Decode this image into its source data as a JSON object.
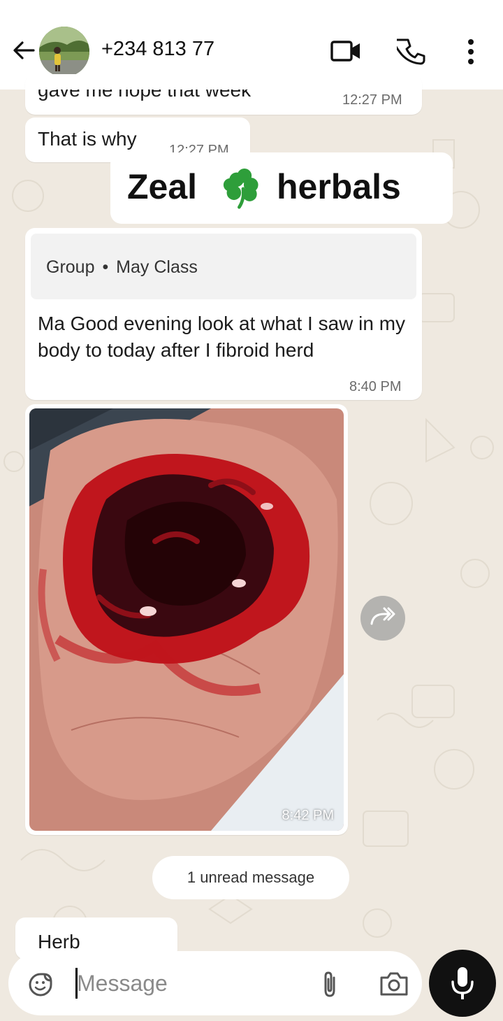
{
  "header": {
    "contact": "+234 813 77       "
  },
  "messages": {
    "m1": {
      "text": "gave me hope that week",
      "time": "12:27 PM"
    },
    "m2": {
      "text": "That is why",
      "time": "12:27 PM"
    },
    "m3": {
      "quote_group": "Group",
      "quote_sep": "•",
      "quote_name": "May Class",
      "text": "Ma Good evening look at what I saw in my body to today after I fibroid herd",
      "time": "8:40 PM"
    },
    "m4": {
      "time": "8:42 PM"
    },
    "m5": {
      "text": "Herb"
    }
  },
  "watermark": {
    "left": "Zeal",
    "right": "herbals",
    "icon": "shamrock-icon"
  },
  "unread": {
    "text": "1 unread message"
  },
  "composer": {
    "placeholder": "Message"
  },
  "colors": {
    "accent": "#111111",
    "wallpaper": "#efe9e0",
    "shamrock": "#2e9e3a"
  }
}
